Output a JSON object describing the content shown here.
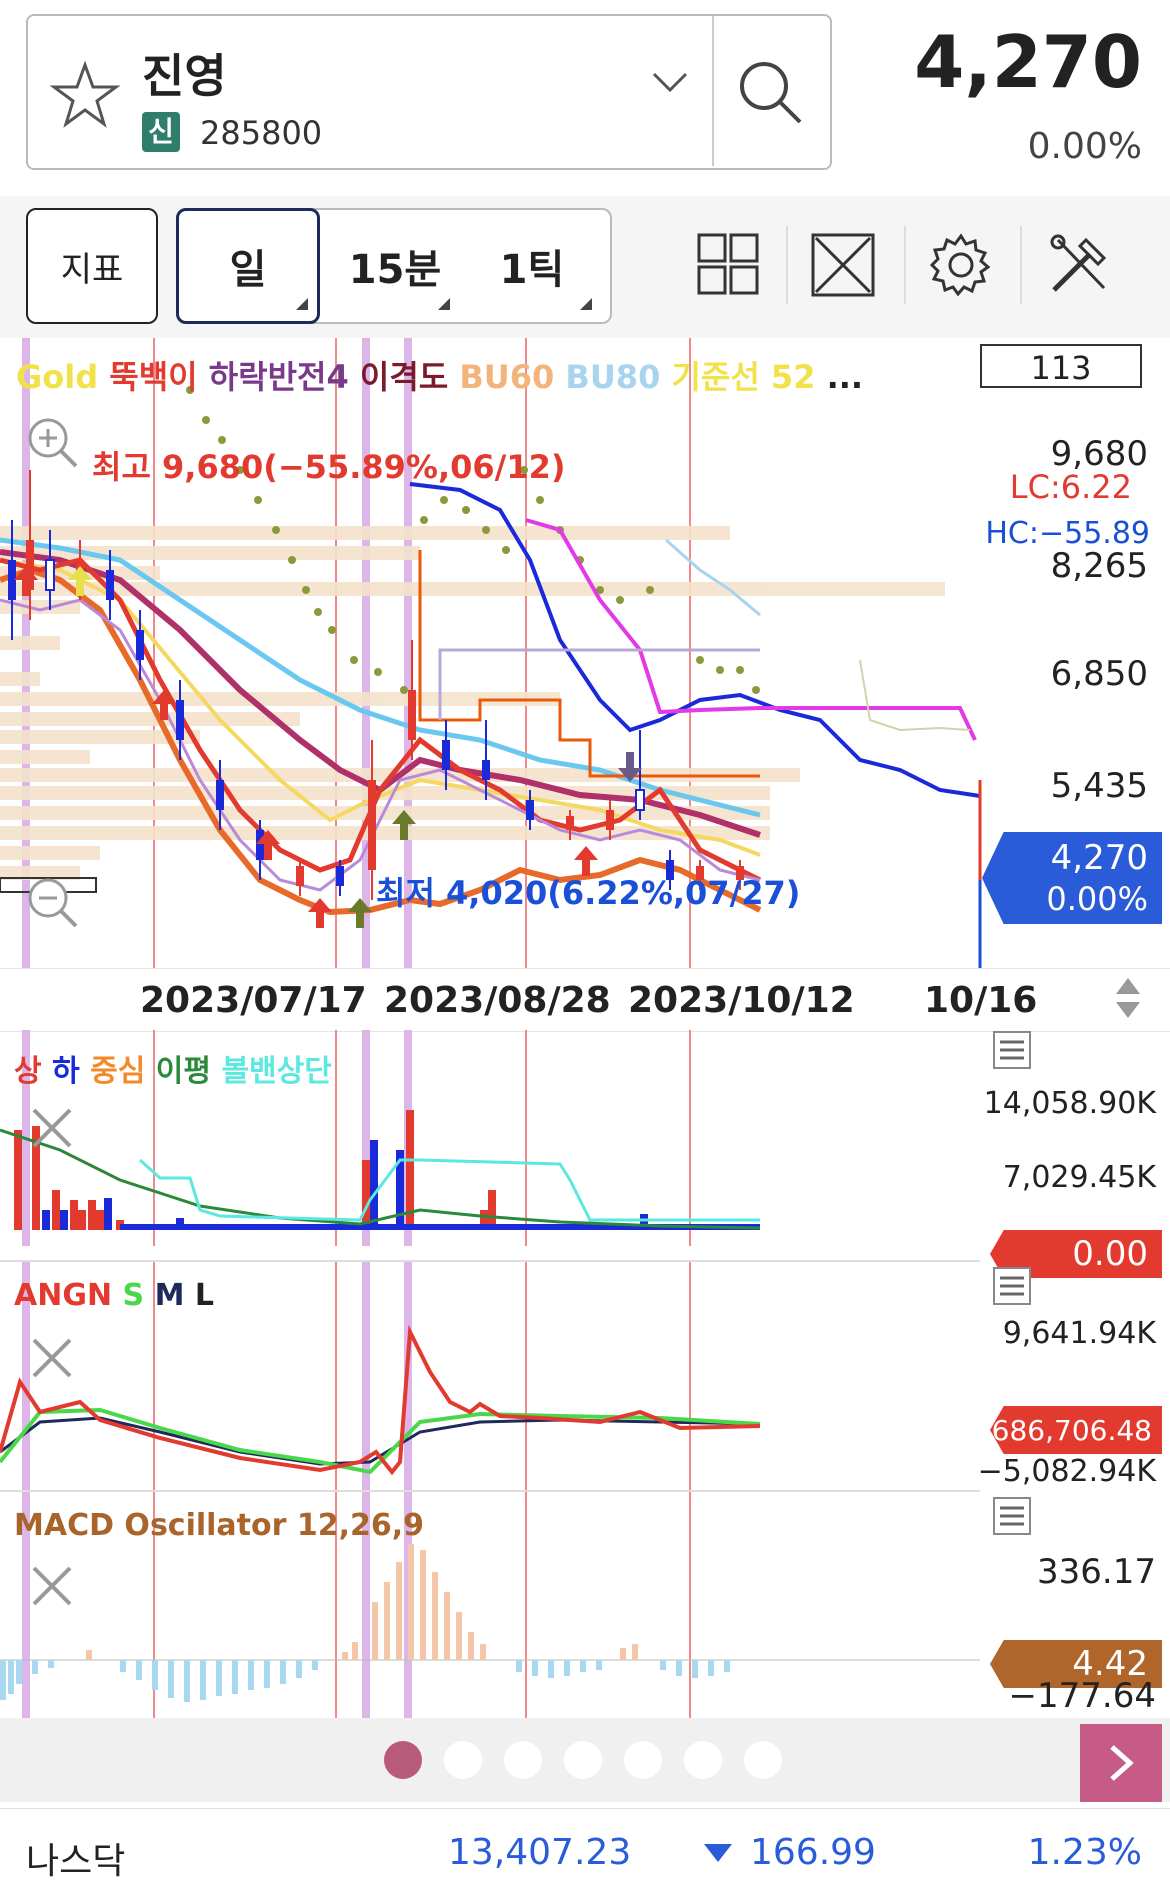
{
  "header": {
    "stock_name": "진영",
    "badge": "신",
    "code": "285800",
    "price": "4,270",
    "change": "0.00%"
  },
  "toolbar": {
    "indicator_label": "지표",
    "periods": [
      "일",
      "15분",
      "1틱"
    ],
    "selected_period": "일",
    "icons": [
      "layout-grid-icon",
      "fullscreen-icon",
      "settings-gear-icon",
      "tools-icon"
    ]
  },
  "main_chart": {
    "legend": [
      {
        "text": "Gold",
        "color": "#f2e24a"
      },
      {
        "text": "뚝백이",
        "color": "#e23a2e"
      },
      {
        "text": "하락반전4",
        "color": "#7a3a8a"
      },
      {
        "text": "이격도",
        "color": "#7a1a2a"
      },
      {
        "text": "BU60",
        "color": "#f2b47a"
      },
      {
        "text": "BU80",
        "color": "#a8d4ee"
      },
      {
        "text": "기준선 52",
        "color": "#f2e24a"
      },
      {
        "text": "...",
        "color": "#222222"
      }
    ],
    "count_box": "113",
    "high_label": "최고 9,680(−55.89%,06/12)",
    "low_label": "최저 4,020(6.22%,07/27)",
    "price_axis": [
      "9,680",
      "8,265",
      "6,850",
      "5,435"
    ],
    "lc_label": "LC:6.22",
    "hc_label": "HC:−55.89",
    "current_tag_price": "4,270",
    "current_tag_change": "0.00%",
    "x_axis": [
      "2023/07/17",
      "2023/08/28",
      "2023/10/12",
      "10/16"
    ]
  },
  "volume_panel": {
    "legend": [
      {
        "text": "상",
        "color": "#e23a2e"
      },
      {
        "text": "하",
        "color": "#1a2ad8"
      },
      {
        "text": "중심",
        "color": "#f28a2a"
      },
      {
        "text": "이평",
        "color": "#2a8a3a"
      },
      {
        "text": "볼밴상단",
        "color": "#5ae8e0"
      }
    ],
    "axis": [
      "14,058.90K",
      "7,029.45K"
    ],
    "tag": "0.00"
  },
  "angn_panel": {
    "legend": [
      {
        "text": "ANGN",
        "color": "#e23a2e"
      },
      {
        "text": "S",
        "color": "#4ad84a"
      },
      {
        "text": "M",
        "color": "#1d2a5a"
      },
      {
        "text": "L",
        "color": "#222222"
      }
    ],
    "axis": [
      "9,641.94K",
      "−5,082.94K"
    ],
    "tag": "686,706.48"
  },
  "macd_panel": {
    "title": "MACD Oscillator 12,26,9",
    "axis": [
      "336.17",
      "−177.64"
    ],
    "tag": "4.42"
  },
  "pager": {
    "pages": 7,
    "active": 0
  },
  "ticker": {
    "name": "나스닥",
    "value": "13,407.23",
    "change": "166.99",
    "pct": "1.23%"
  },
  "colors": {
    "up": "#e23a2e",
    "down": "#1a4fd8",
    "accent": "#c65b87",
    "current_tag": "#2a5bd8"
  }
}
